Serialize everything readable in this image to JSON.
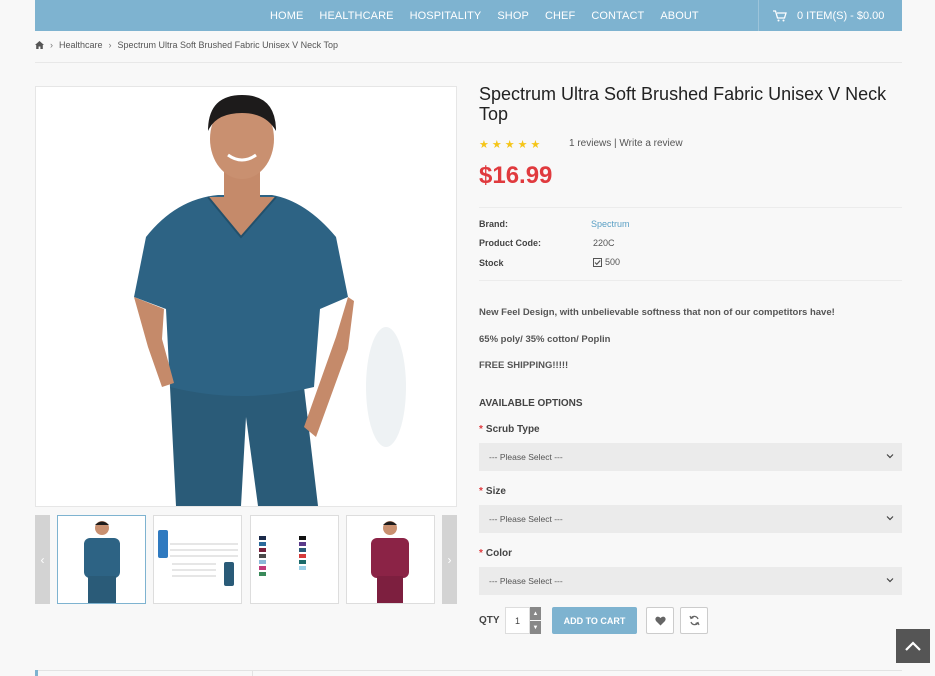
{
  "nav": {
    "items": [
      "HOME",
      "HEALTHCARE",
      "HOSPITALITY",
      "SHOP",
      "CHEF",
      "CONTACT",
      "ABOUT"
    ],
    "cart_label": "0 ITEM(S) - $0.00"
  },
  "breadcrumb": {
    "category": "Healthcare",
    "current": "Spectrum Ultra Soft Brushed Fabric Unisex V Neck Top"
  },
  "product": {
    "title": "Spectrum Ultra Soft Brushed Fabric Unisex V Neck Top",
    "rating": 5,
    "reviews_text": "1 reviews | Write a review",
    "price": "$16.99",
    "brand_label": "Brand:",
    "brand_value": "Spectrum",
    "code_label": "Product Code:",
    "code_value": "220C",
    "stock_label": "Stock",
    "stock_value": "500",
    "desc1": "New Feel Design, with unbelievable softness that non of our competitors have!",
    "desc2": "65% poly/ 35% cotton/ Poplin",
    "desc3": "FREE SHIPPING!!!!!"
  },
  "options": {
    "heading": "AVAILABLE OPTIONS",
    "scrub_label": "Scrub Type",
    "size_label": "Size",
    "color_label": "Color",
    "placeholder": "--- Please Select ---"
  },
  "cart": {
    "qty_label": "QTY",
    "qty_value": "1",
    "add_label": "ADD TO CART"
  },
  "colors": {
    "accent": "#7eb3d0",
    "price": "#e03a3e",
    "scrub_blue": "#2d5f7c",
    "scrub_wine": "#8b2346"
  }
}
